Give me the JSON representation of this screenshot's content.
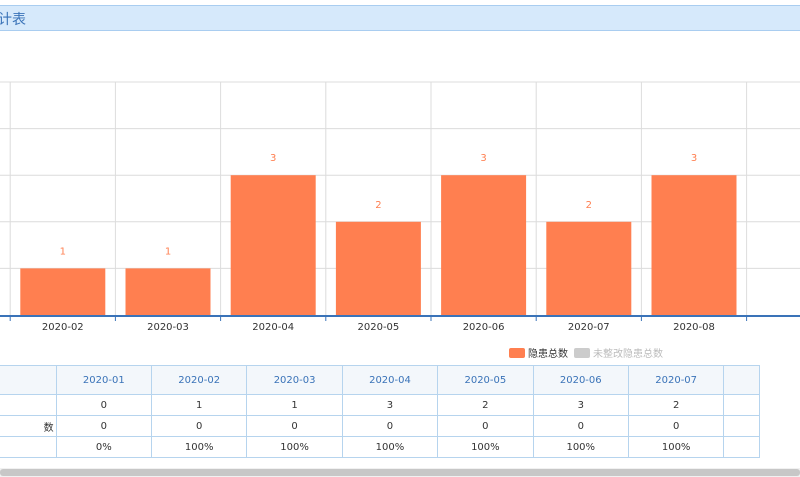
{
  "header": {
    "title": "计表"
  },
  "chart_data": {
    "type": "bar",
    "categories": [
      "2020-01",
      "2020-02",
      "2020-03",
      "2020-04",
      "2020-05",
      "2020-06",
      "2020-07",
      "2020-08"
    ],
    "series": [
      {
        "name": "隐患总数",
        "values": [
          0,
          1,
          1,
          3,
          2,
          3,
          2,
          3
        ],
        "color": "#ff7f50"
      },
      {
        "name": "未整改隐患总数",
        "values": [
          0,
          0,
          0,
          0,
          0,
          0,
          0,
          0
        ],
        "color": "#cccccc"
      }
    ],
    "ylim": [
      0,
      5
    ],
    "grid": true,
    "legend_position": "bottom-right"
  },
  "legend": [
    {
      "label": "隐患总数",
      "color": "#ff7f50"
    },
    {
      "label": "未整改隐患总数",
      "color": "#cccccc"
    }
  ],
  "table": {
    "header_cells": [
      "",
      "2020-01",
      "2020-02",
      "2020-03",
      "2020-04",
      "2020-05",
      "2020-06",
      "2020-07",
      ""
    ],
    "rows": [
      {
        "label": "",
        "cells": [
          "0",
          "1",
          "1",
          "3",
          "2",
          "3",
          "2",
          ""
        ]
      },
      {
        "label": "数",
        "cells": [
          "0",
          "0",
          "0",
          "0",
          "0",
          "0",
          "0",
          ""
        ]
      },
      {
        "label": "",
        "cells": [
          "0%",
          "100%",
          "100%",
          "100%",
          "100%",
          "100%",
          "100%",
          ""
        ]
      }
    ]
  }
}
